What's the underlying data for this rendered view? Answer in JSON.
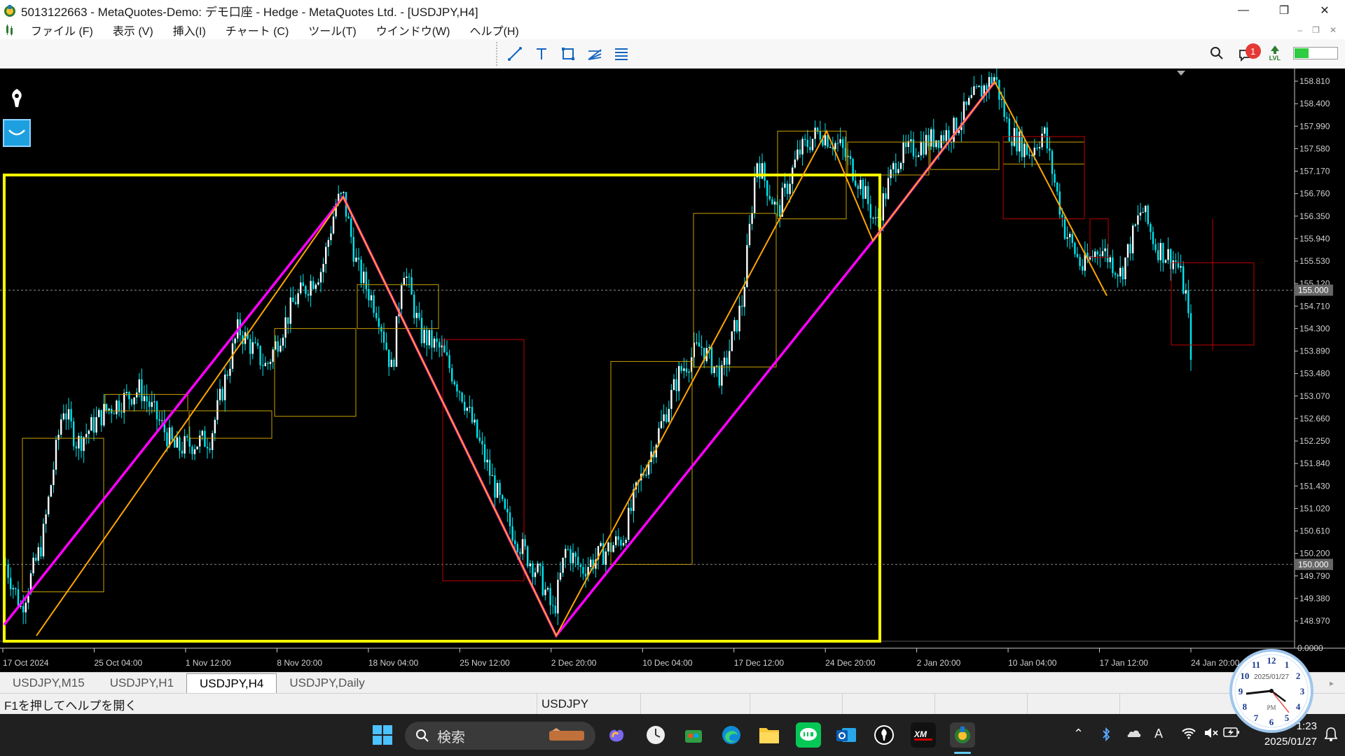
{
  "window": {
    "title": "5013122663 - MetaQuotes-Demo: デモ口座 - Hedge - MetaQuotes Ltd. - [USDJPY,H4]",
    "controls": {
      "minimize": "—",
      "restore": "❐",
      "close": "✕"
    }
  },
  "menu": {
    "items": [
      "ファイル (F)",
      "表示 (V)",
      "挿入(I)",
      "チャート (C)",
      "ツール(T)",
      "ウインドウ(W)",
      "ヘルプ(H)"
    ],
    "mdi_controls": [
      "–",
      "❐",
      "✕"
    ]
  },
  "toolbar": {
    "tools": [
      "trendline-icon",
      "text-tool-icon",
      "rectangle-tool-icon",
      "fibonacci-fan-icon",
      "fibonacci-levels-icon"
    ],
    "notification_count": "1",
    "level_label": "LVL",
    "battery_fraction": 0.32
  },
  "chart": {
    "symbol": "USDJPY",
    "timeframe": "H4",
    "price_axis": [
      "158.810",
      "158.400",
      "157.990",
      "157.580",
      "157.170",
      "156.760",
      "156.350",
      "155.940",
      "155.530",
      "155.120",
      "154.710",
      "154.300",
      "153.890",
      "153.480",
      "153.070",
      "152.660",
      "152.250",
      "151.840",
      "151.430",
      "151.020",
      "150.610",
      "150.200",
      "149.790",
      "149.380",
      "148.970"
    ],
    "hlines": [
      "155.000",
      "150.000"
    ],
    "sub_window_value": "0.0000",
    "time_axis": [
      "17 Oct 2024",
      "25 Oct 04:00",
      "1 Nov 12:00",
      "8 Nov 20:00",
      "18 Nov 04:00",
      "25 Nov 12:00",
      "2 Dec 20:00",
      "10 Dec 04:00",
      "17 Dec 12:00",
      "24 Dec 20:00",
      "2 Jan 20:00",
      "10 Jan 04:00",
      "17 Jan 12:00",
      "24 Jan 20:00"
    ],
    "colors": {
      "candle": "#00e5ee",
      "magenta_zigzag": "#ff00ff",
      "orange_zigzag": "#ffa500",
      "big_box": "#ffff00",
      "box_gold": "#c9a000",
      "box_red": "#c00000"
    }
  },
  "tabs": [
    "USDJPY,M15",
    "USDJPY,H1",
    "USDJPY,H4",
    "USDJPY,Daily"
  ],
  "active_tab": 2,
  "status": {
    "help": "F1を押してヘルプを開く",
    "symbol": "USDJPY"
  },
  "taskbar": {
    "search_placeholder": "検索",
    "time": "1:23",
    "date": "2025/01/27",
    "analog_clock": {
      "date": "2025/01/27",
      "ampm": "PM"
    }
  }
}
